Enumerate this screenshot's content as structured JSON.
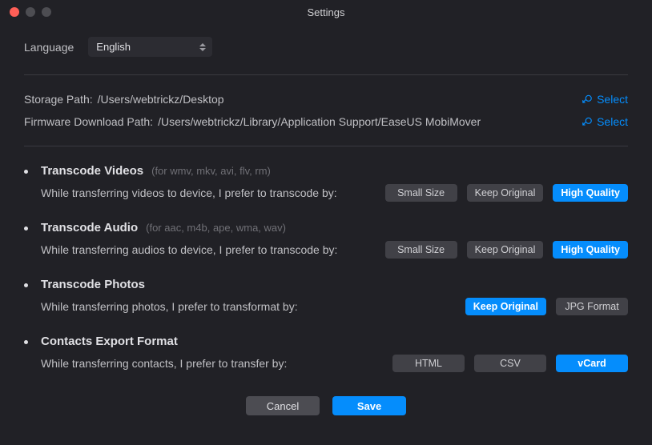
{
  "window": {
    "title": "Settings"
  },
  "language": {
    "label": "Language",
    "value": "English"
  },
  "paths": {
    "storage": {
      "label": "Storage Path:",
      "value": "/Users/webtrickz/Desktop",
      "action": "Select"
    },
    "firmware": {
      "label": "Firmware Download Path:",
      "value": "/Users/webtrickz/Library/Application Support/EaseUS MobiMover",
      "action": "Select"
    }
  },
  "transcode": {
    "videos": {
      "title": "Transcode Videos",
      "hint": "(for wmv, mkv, avi, flv, rm)",
      "desc": "While transferring videos to device, I prefer to transcode by:",
      "options": [
        "Small Size",
        "Keep Original",
        "High Quality"
      ],
      "selected": "High Quality"
    },
    "audio": {
      "title": "Transcode Audio",
      "hint": "(for aac, m4b, ape, wma, wav)",
      "desc": "While transferring audios to device, I prefer to transcode by:",
      "options": [
        "Small Size",
        "Keep Original",
        "High Quality"
      ],
      "selected": "High Quality"
    },
    "photos": {
      "title": "Transcode Photos",
      "desc": "While transferring photos, I prefer to transformat by:",
      "options": [
        "Keep Original",
        "JPG Format"
      ],
      "selected": "Keep Original"
    },
    "contacts": {
      "title": "Contacts Export Format",
      "desc": "While transferring contacts, I prefer to transfer by:",
      "options": [
        "HTML",
        "CSV",
        "vCard"
      ],
      "selected": "vCard"
    }
  },
  "footer": {
    "cancel": "Cancel",
    "save": "Save"
  }
}
